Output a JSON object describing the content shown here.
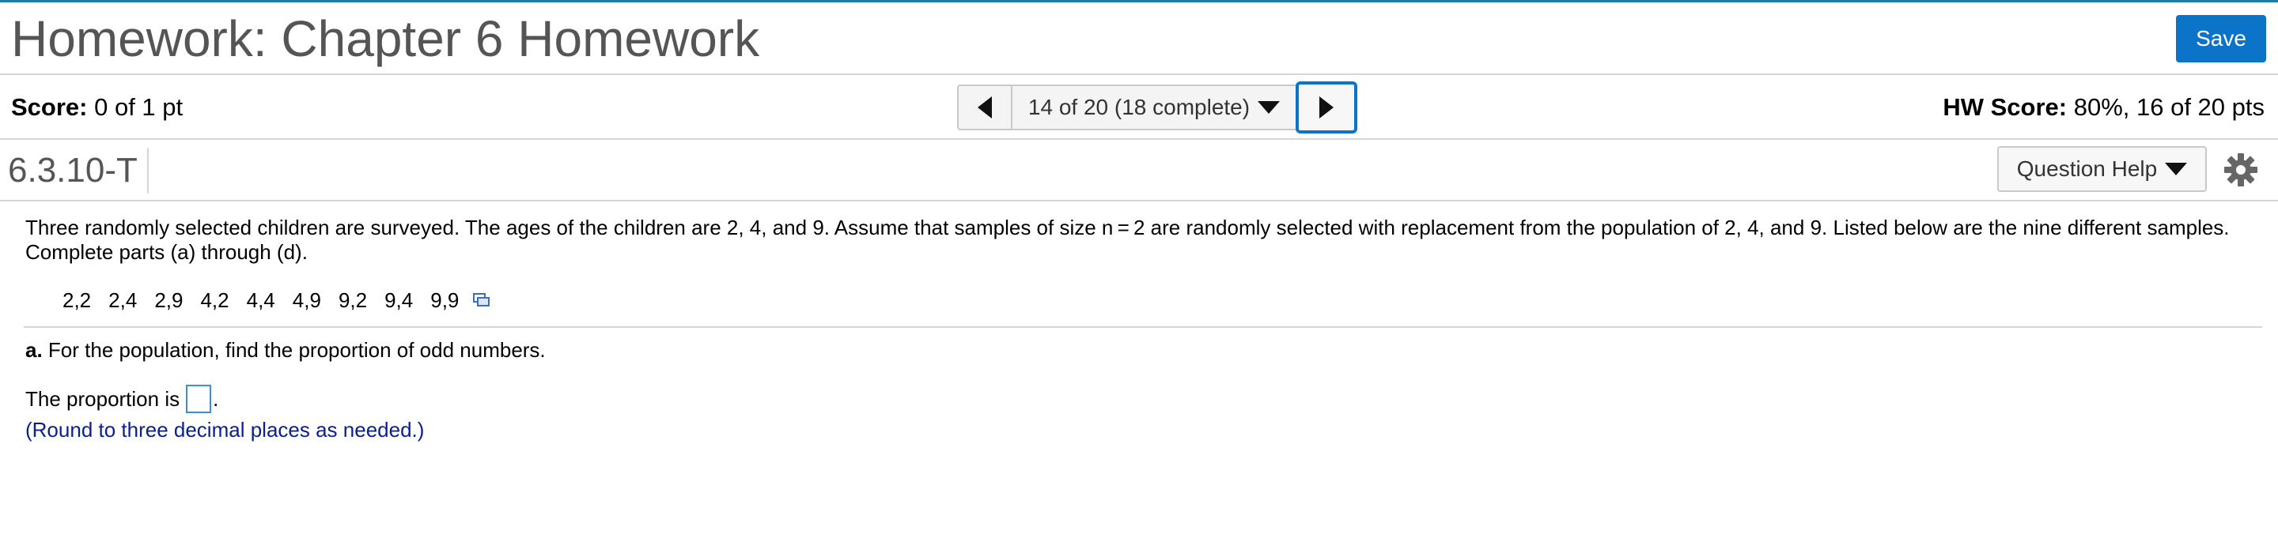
{
  "header": {
    "title": "Homework: Chapter 6 Homework",
    "save_label": "Save"
  },
  "score": {
    "label": "Score:",
    "value": "0 of 1 pt",
    "hw_label": "HW Score:",
    "hw_value": "80%, 16 of 20 pts"
  },
  "navigation": {
    "position_label": "14 of 20 (18 complete)"
  },
  "question": {
    "id": "6.3.10-T",
    "help_label": "Question Help",
    "prompt": "Three randomly selected children are surveyed. The ages of the children are 2, 4, and 9. Assume that samples of size n = 2 are randomly selected with replacement from the population of 2, 4, and 9. Listed below are the nine different samples. Complete parts (a) through (d).",
    "samples": [
      "2,2",
      "2,4",
      "2,9",
      "4,2",
      "4,4",
      "4,9",
      "9,2",
      "9,4",
      "9,9"
    ],
    "part_a_label": "a.",
    "part_a_text": "For the population, find the proportion of odd numbers.",
    "answer_prefix": "The proportion is",
    "answer_suffix": ".",
    "answer_value": "",
    "hint": "(Round to three decimal places as needed.)"
  },
  "colors": {
    "accent": "#0b74c9",
    "hint_text": "#0a1f8f",
    "title_text": "#555555"
  },
  "icons": {
    "prev": "triangle-left-icon",
    "next": "triangle-right-icon",
    "dropdown": "caret-down-icon",
    "settings": "gear-icon",
    "copy": "copy-data-icon"
  }
}
